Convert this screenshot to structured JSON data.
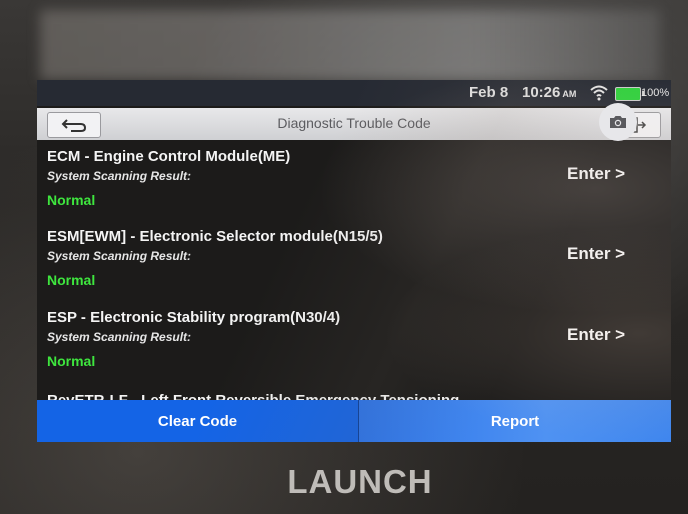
{
  "status_bar": {
    "date": "Feb 8",
    "time": "10:26",
    "ampm": "AM",
    "battery": "100%"
  },
  "header": {
    "title": "Diagnostic Trouble Code"
  },
  "modules": [
    {
      "name": "ECM - Engine Control Module(ME)",
      "subtitle": "System Scanning Result:",
      "status": "Normal",
      "action": "Enter >"
    },
    {
      "name": "ESM[EWM] - Electronic Selector module(N15/5)",
      "subtitle": "System Scanning Result:",
      "status": "Normal",
      "action": "Enter >"
    },
    {
      "name": "ESP - Electronic Stability program(N30/4)",
      "subtitle": "System Scanning Result:",
      "status": "Normal",
      "action": "Enter >"
    },
    {
      "name": "RevETR-LF - Left Front Reversible Emergency Tensioning"
    }
  ],
  "footer": {
    "clear_code": "Clear Code",
    "report": "Report"
  },
  "brand": "LAUNCH",
  "colors": {
    "status_normal": "#3ee63e",
    "button_bar": "#1464e6"
  },
  "icons": [
    "back-icon",
    "exit-icon",
    "wifi-icon",
    "battery-icon",
    "camera-icon"
  ]
}
